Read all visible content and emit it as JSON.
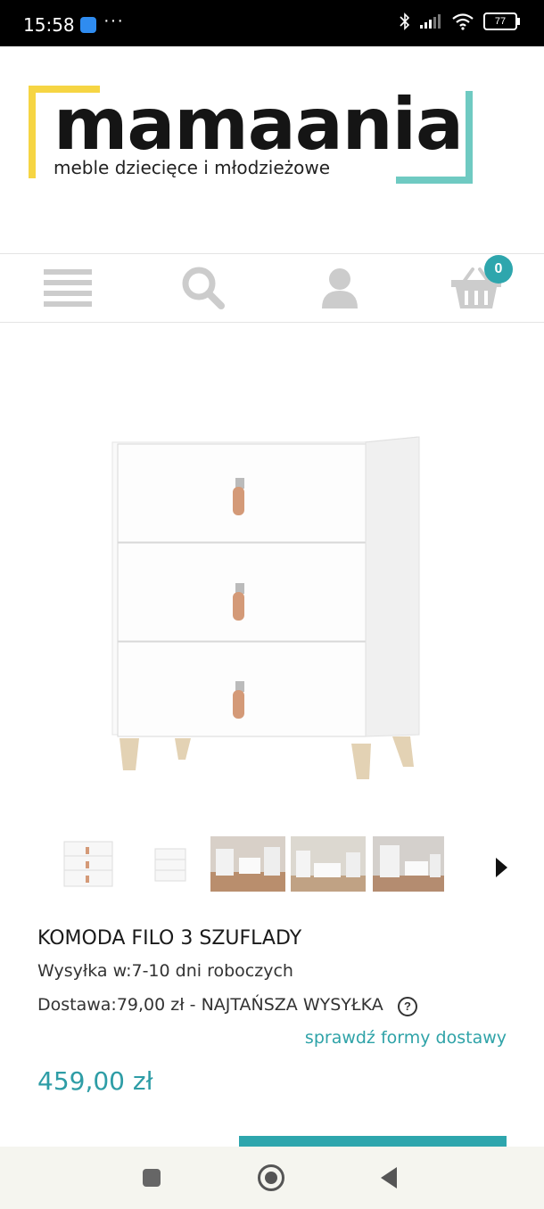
{
  "status": {
    "time": "15:58",
    "more": "···",
    "battery": "77"
  },
  "logo": {
    "name": "mamaania",
    "tagline": "meble dziecięce i młodzieżowe",
    "colors": {
      "yellow": "#f6d543",
      "teal": "#6fcac2"
    }
  },
  "nav": {
    "cart_count": "0",
    "icons": [
      "menu-icon",
      "search-icon",
      "user-icon",
      "basket-icon"
    ]
  },
  "product": {
    "title": "KOMODA FILO 3 SZUFLADY",
    "shipping": "Wysyłka w:7-10 dni roboczych",
    "delivery": "Dostawa:79,00 zł - NAJTAŃSZA WYSYŁKA",
    "help": "?",
    "check_link": "sprawdź formy dostawy",
    "price": "459,00 zł"
  },
  "colors": {
    "accent": "#2ea6ad"
  }
}
